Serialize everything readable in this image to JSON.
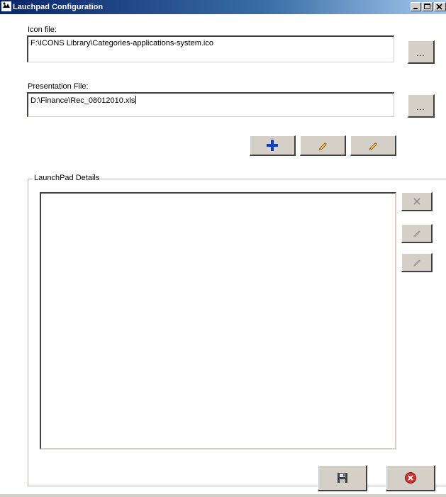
{
  "window": {
    "title": "Lauchpad Configuration",
    "controls": {
      "minimize_icon": "minimize-icon",
      "maximize_icon": "maximize-icon",
      "close_icon": "close-icon"
    }
  },
  "icon_file": {
    "label": "Icon file:",
    "value": "F:\\ICONS Library\\Categories-applications-system.ico",
    "browse_label": "..."
  },
  "presentation_file": {
    "label": "Presentation File:",
    "value": "D:\\Finance\\Rec_08012010.xls",
    "browse_label": "..."
  },
  "toolbar": {
    "add_icon": "plus-icon",
    "edit_icon": "pencil-icon",
    "edit2_icon": "pencil-icon"
  },
  "launchpad_details": {
    "title": "LaunchPad Details",
    "items": [],
    "side_buttons": {
      "delete_icon": "x-icon",
      "edit_icon": "pencil-icon",
      "edit2_icon": "pencil-icon"
    }
  },
  "footer": {
    "save_icon": "floppy-disk-icon",
    "cancel_icon": "cancel-circle-icon"
  },
  "colors": {
    "titlebar_start": "#0a246a",
    "titlebar_end": "#a6caf0",
    "button_face": "#d4d0c8",
    "add_blue": "#1040c0",
    "cancel_red": "#d03030"
  }
}
